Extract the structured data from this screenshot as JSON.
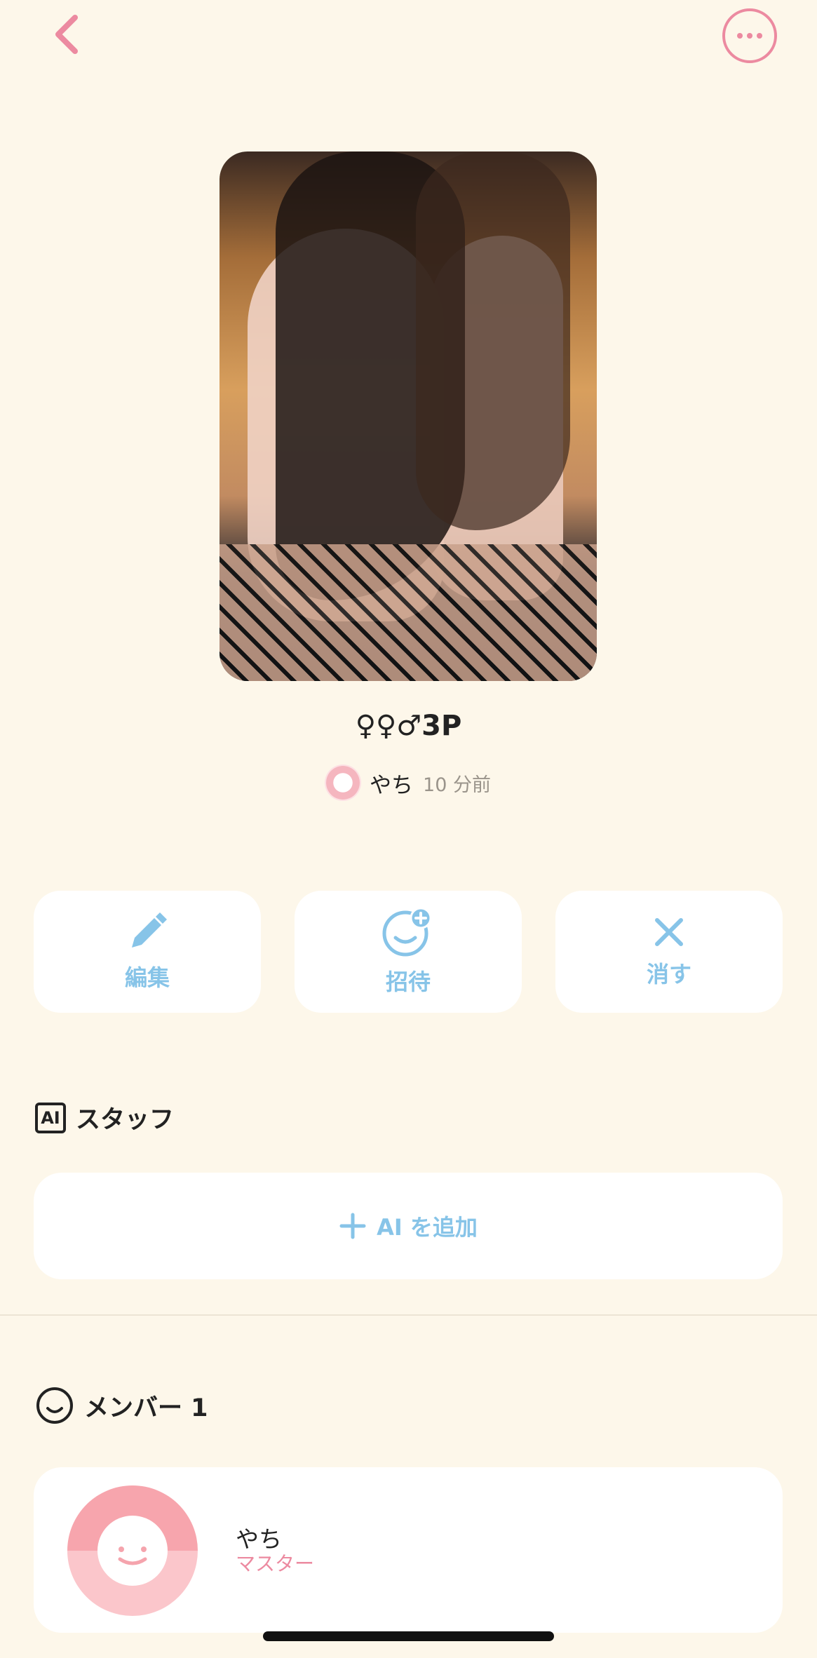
{
  "header": {
    "back_icon": "chevron-left-icon",
    "more_icon": "ellipsis-circle-icon"
  },
  "room": {
    "title": "♀♀♂3P",
    "owner_name": "やち",
    "time_ago": "10 分前"
  },
  "actions": [
    {
      "label": "編集",
      "icon": "pencil-icon"
    },
    {
      "label": "招待",
      "icon": "add-face-icon"
    },
    {
      "label": "消す",
      "icon": "close-icon"
    }
  ],
  "staff": {
    "title": "スタッフ",
    "badge": "AI",
    "add_label": "AI を追加"
  },
  "members": {
    "title": "メンバー 1",
    "items": [
      {
        "name": "やち",
        "role": "マスター"
      }
    ]
  },
  "colors": {
    "accent_pink": "#ec8aa0",
    "accent_blue": "#87c4e8",
    "background": "#fdf7ea"
  }
}
